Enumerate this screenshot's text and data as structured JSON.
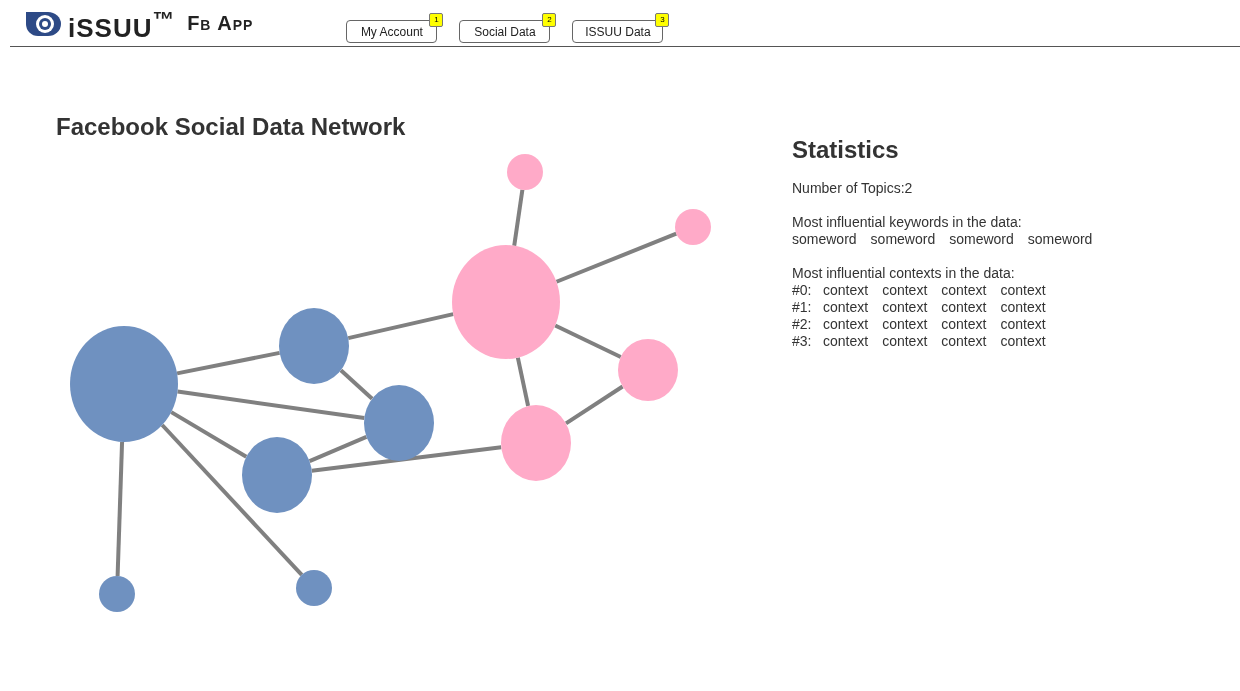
{
  "header": {
    "brand": "iSSUU$^{™}$",
    "app_name": "Fb App",
    "nav": [
      {
        "label": "My Account",
        "badge": "1"
      },
      {
        "label": "Social Data",
        "badge": "2"
      },
      {
        "label": "ISSUU Data",
        "badge": "3"
      }
    ]
  },
  "network": {
    "title": "Facebook Social Data Network",
    "nodes": [
      {
        "color": "#ffaac8"
      },
      {
        "color": "#ffaac8"
      },
      {
        "color": "#ffaac8"
      },
      {
        "color": "#ffaac8"
      },
      {
        "color": "#ffaac8"
      },
      {
        "color": "#6f91c0"
      },
      {
        "color": "#6f91c0"
      },
      {
        "color": "#6f91c0"
      },
      {
        "color": "#6f91c0"
      },
      {
        "color": "#6f91c0"
      },
      {
        "color": "#6f91c0"
      }
    ]
  },
  "statistics": {
    "title": "Statistics",
    "topics": "Number of Topics:2",
    "keywords_heading": "Most influential keywords in the data:",
    "keywords": [
      "someword",
      "someword",
      "someword",
      "someword"
    ],
    "contexts_heading": "Most influential contexts in the data:",
    "contexts": [
      {
        "index": "#0:",
        "items": [
          "context",
          "context",
          "context",
          "context"
        ]
      },
      {
        "index": "#1:",
        "items": [
          "context",
          "context",
          "context",
          "context"
        ]
      },
      {
        "index": "#2:",
        "items": [
          "context",
          "context",
          "context",
          "context"
        ]
      },
      {
        "index": "#3:",
        "items": [
          "context",
          "context",
          "context",
          "context"
        ]
      }
    ]
  }
}
